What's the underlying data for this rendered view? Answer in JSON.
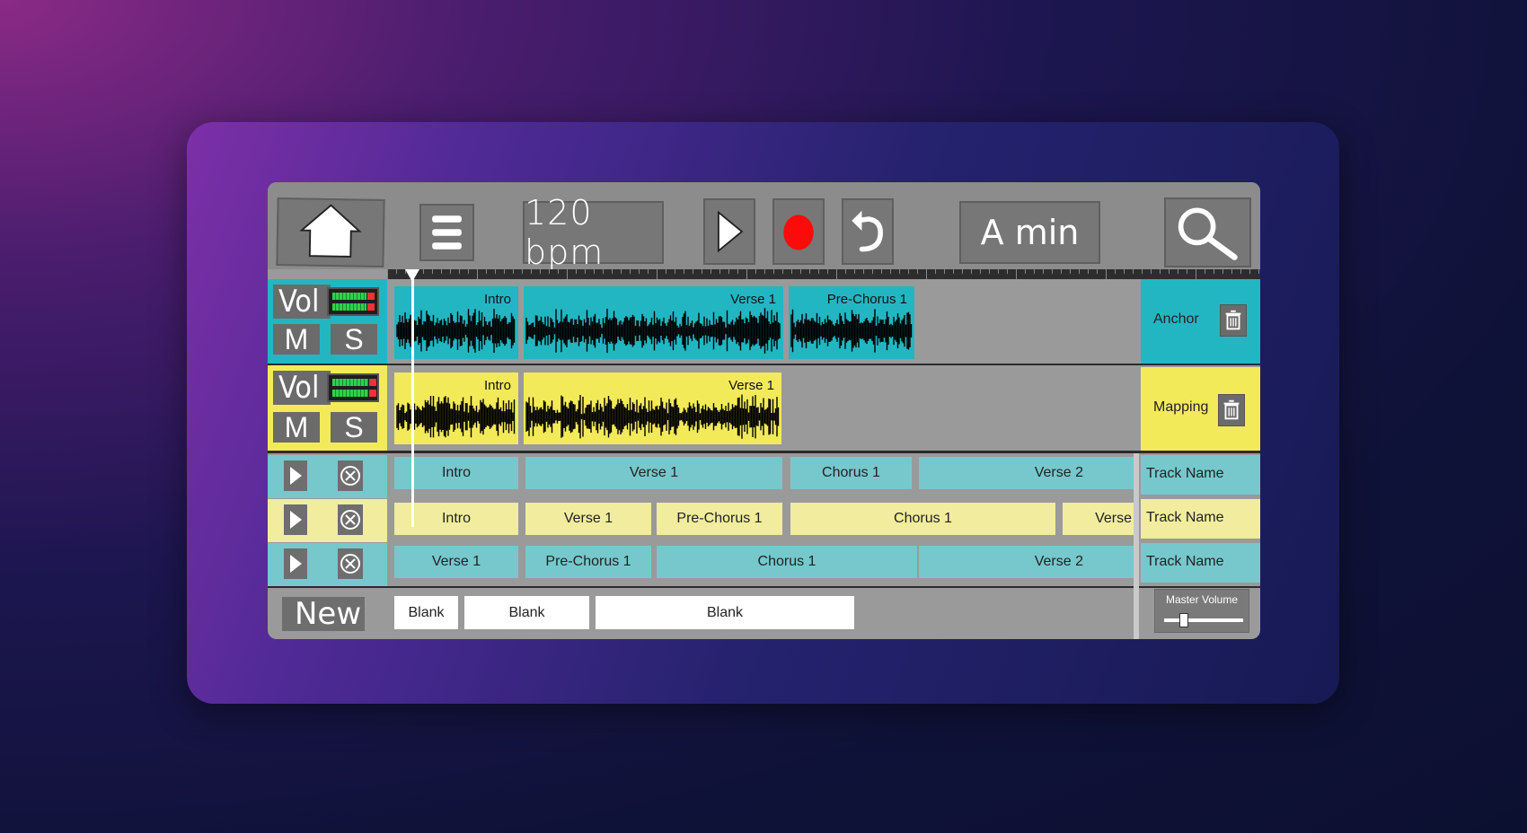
{
  "toolbar": {
    "bpm": "120 bpm",
    "key": "A min"
  },
  "tracks": [
    {
      "vol_label": "Vol",
      "mute_label": "M",
      "solo_label": "S",
      "name": "Anchor",
      "color": "#22b6c2",
      "meter_level": 0.8,
      "clips": [
        {
          "label": "Intro"
        },
        {
          "label": "Verse 1"
        },
        {
          "label": "Pre-Chorus 1"
        }
      ]
    },
    {
      "vol_label": "Vol",
      "mute_label": "M",
      "solo_label": "S",
      "name": "Mapping",
      "color": "#f3ea5a",
      "meter_level": 0.85,
      "clips": [
        {
          "label": "Intro"
        },
        {
          "label": "Verse 1"
        }
      ]
    }
  ],
  "arrangements": [
    {
      "color": "cyan",
      "track_name": "Track Name",
      "segments": [
        "Intro",
        "Verse 1",
        "Chorus 1",
        "Verse 2"
      ]
    },
    {
      "color": "yellow",
      "track_name": "Track Name",
      "segments": [
        "Intro",
        "Verse 1",
        "Pre-Chorus 1",
        "Chorus 1",
        "Verse"
      ]
    },
    {
      "color": "cyan",
      "track_name": "Track Name",
      "segments": [
        "Verse 1",
        "Pre-Chorus 1",
        "Chorus 1",
        "Verse 2"
      ]
    }
  ],
  "new_row": {
    "new_label": "New",
    "blanks": [
      "Blank",
      "Blank",
      "Blank"
    ]
  },
  "master": {
    "label": "Master Volume",
    "level": 0.25
  },
  "icons": [
    "home-icon",
    "menu-icon",
    "play-icon",
    "record-icon",
    "undo-icon",
    "search-icon",
    "trash-icon",
    "close-icon"
  ]
}
